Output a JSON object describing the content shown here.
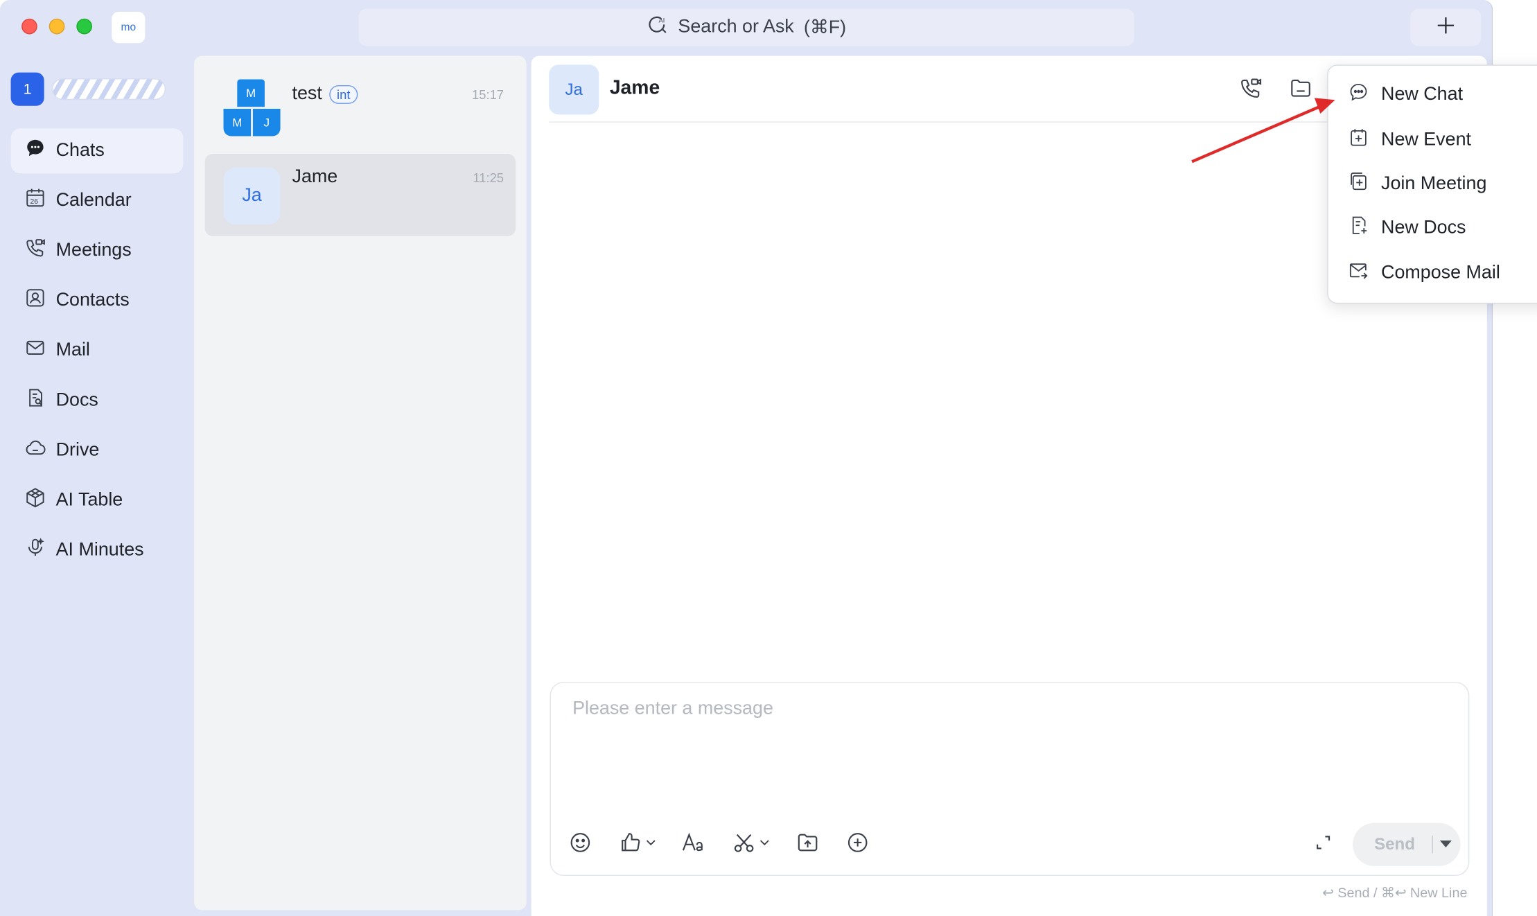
{
  "titlebar": {
    "workspace_badge": "mo",
    "search_text": "Search or Ask",
    "search_shortcut": "(⌘F)"
  },
  "user": {
    "number": "1"
  },
  "nav": {
    "items": [
      {
        "label": "Chats",
        "icon": "chat-bubble-icon",
        "active": true
      },
      {
        "label": "Calendar",
        "icon": "calendar-icon",
        "active": false
      },
      {
        "label": "Meetings",
        "icon": "meetings-icon",
        "active": false
      },
      {
        "label": "Contacts",
        "icon": "contacts-icon",
        "active": false
      },
      {
        "label": "Mail",
        "icon": "mail-icon",
        "active": false
      },
      {
        "label": "Docs",
        "icon": "docs-icon",
        "active": false
      },
      {
        "label": "Drive",
        "icon": "drive-icon",
        "active": false
      },
      {
        "label": "AI Table",
        "icon": "ai-table-icon",
        "active": false
      },
      {
        "label": "AI Minutes",
        "icon": "ai-minutes-icon",
        "active": false
      }
    ],
    "calendar_day": "26"
  },
  "chat_list": [
    {
      "name": "test",
      "tag": "int",
      "time": "15:17",
      "avatar_cells": [
        "M",
        "M",
        "J"
      ]
    },
    {
      "name": "Jame",
      "time": "11:25",
      "avatar": "Ja",
      "selected": true
    }
  ],
  "conversation": {
    "avatar": "Ja",
    "title": "Jame",
    "input_placeholder": "Please enter a message",
    "send_label": "Send",
    "hint": "↩ Send / ⌘↩ New Line"
  },
  "menu": {
    "items": [
      {
        "label": "New Chat",
        "icon": "new-chat-icon"
      },
      {
        "label": "New Event",
        "icon": "new-event-icon"
      },
      {
        "label": "Join Meeting",
        "icon": "join-meeting-icon"
      },
      {
        "label": "New Docs",
        "icon": "new-docs-icon"
      },
      {
        "label": "Compose Mail",
        "icon": "compose-mail-icon"
      }
    ]
  },
  "colors": {
    "accent": "#2a62e8",
    "window_bg": "#dfe4f6",
    "annotation_arrow": "#e02a2a"
  }
}
